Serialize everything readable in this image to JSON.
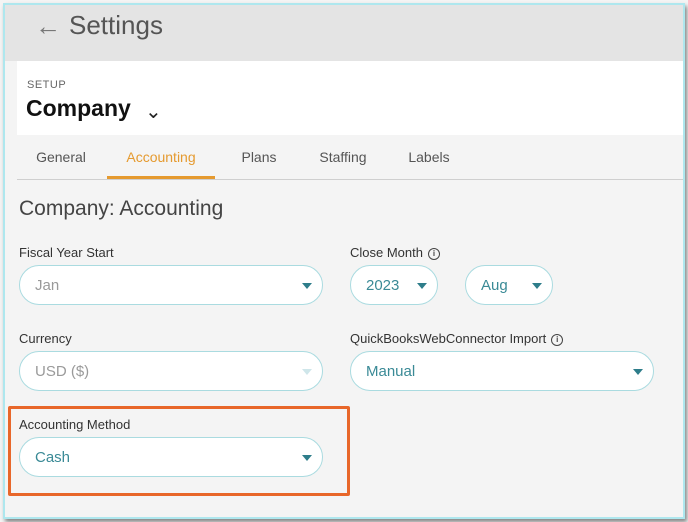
{
  "topbar": {
    "back_icon": "arrow-left-icon",
    "title": "Settings"
  },
  "header": {
    "setup_label": "SETUP",
    "company": "Company"
  },
  "tabs": [
    {
      "label": "General"
    },
    {
      "label": "Accounting",
      "active": true
    },
    {
      "label": "Plans"
    },
    {
      "label": "Staffing"
    },
    {
      "label": "Labels"
    }
  ],
  "section_title": "Company: Accounting",
  "fields": {
    "fiscal_year_start": {
      "label": "Fiscal Year Start",
      "value": "Jan"
    },
    "close_month": {
      "label": "Close Month",
      "year": "2023",
      "month": "Aug"
    },
    "currency": {
      "label": "Currency",
      "value": "USD ($)"
    },
    "qb_import": {
      "label": "QuickBooksWebConnector Import",
      "value": "Manual"
    },
    "accounting_method": {
      "label": "Accounting Method",
      "value": "Cash"
    }
  },
  "colors": {
    "accent_tab": "#e59a2f",
    "highlight": "#e8672a",
    "select_text": "#3a8a96"
  }
}
